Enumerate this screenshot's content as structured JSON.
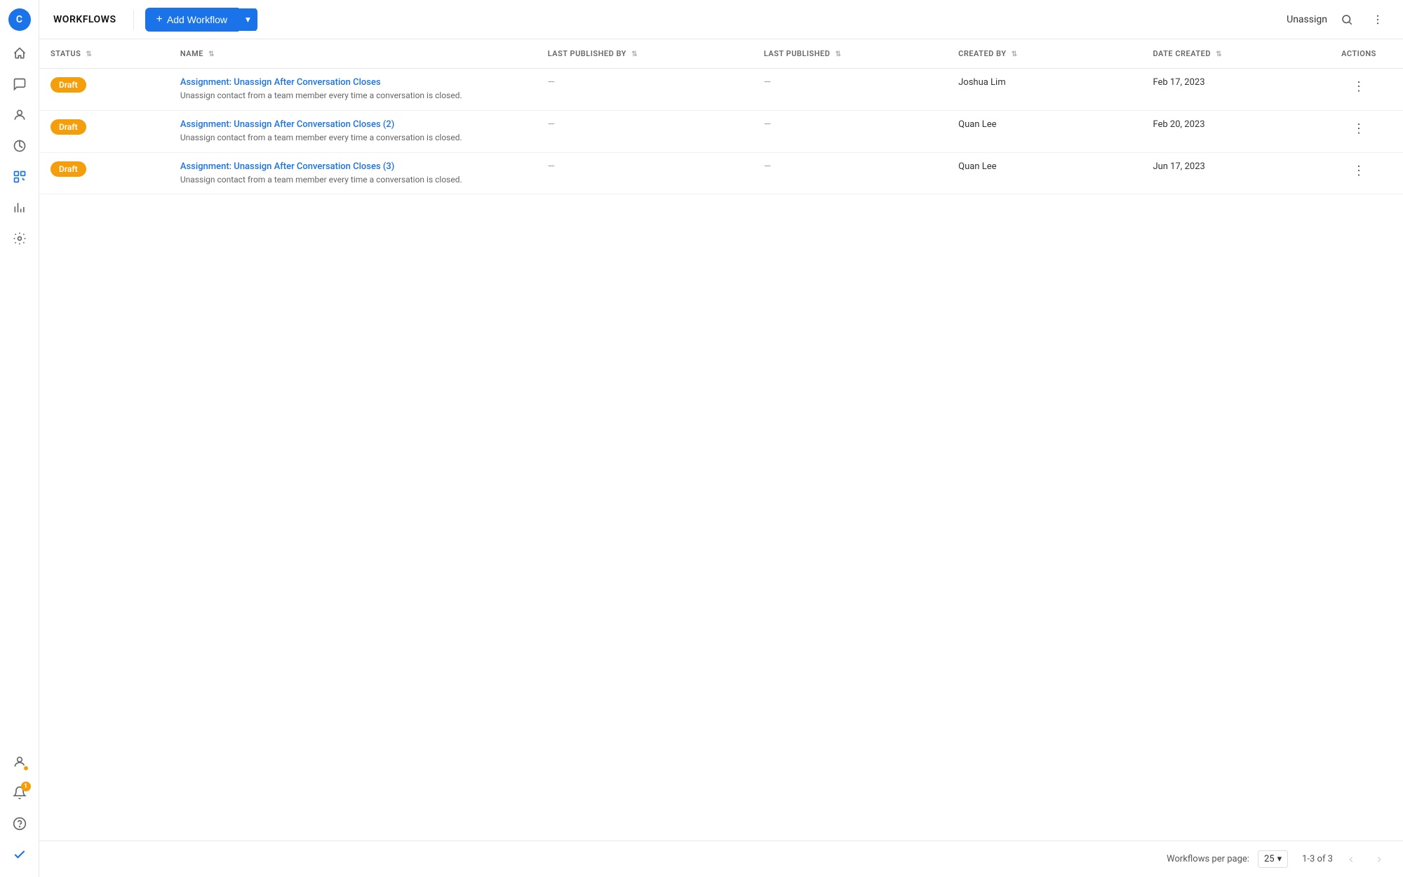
{
  "sidebar": {
    "avatar_letter": "C",
    "items": [
      {
        "name": "nav-home",
        "icon": "home",
        "active": false
      },
      {
        "name": "nav-conversations",
        "icon": "chat",
        "active": false
      },
      {
        "name": "nav-contacts",
        "icon": "person",
        "active": false
      },
      {
        "name": "nav-reports",
        "icon": "chart",
        "active": false
      },
      {
        "name": "nav-workflows",
        "icon": "workflow",
        "active": true
      },
      {
        "name": "nav-analytics",
        "icon": "bar",
        "active": false
      },
      {
        "name": "nav-settings",
        "icon": "gear",
        "active": false
      }
    ],
    "bottom_items": [
      {
        "name": "nav-user-status",
        "icon": "user"
      },
      {
        "name": "nav-notifications",
        "icon": "bell",
        "badge": "1"
      },
      {
        "name": "nav-help",
        "icon": "help"
      },
      {
        "name": "nav-checkmark",
        "icon": "check"
      }
    ]
  },
  "topbar": {
    "title": "WORKFLOWS",
    "add_button_label": "Add Workflow",
    "unassign_label": "Unassign"
  },
  "table": {
    "columns": {
      "status": "STATUS",
      "name": "NAME",
      "last_published_by": "LAST PUBLISHED BY",
      "last_published": "LAST PUBLISHED",
      "created_by": "CREATED BY",
      "date_created": "DATE CREATED",
      "actions": "ACTIONS"
    },
    "rows": [
      {
        "status": "Draft",
        "name": "Assignment: Unassign After Conversation Closes",
        "description": "Unassign contact from a team member every time a conversation is closed.",
        "last_published_by": "—",
        "last_published": "—",
        "created_by": "Joshua Lim",
        "date_created": "Feb 17, 2023"
      },
      {
        "status": "Draft",
        "name": "Assignment: Unassign After Conversation Closes (2)",
        "description": "Unassign contact from a team member every time a conversation is closed.",
        "last_published_by": "—",
        "last_published": "—",
        "created_by": "Quan Lee",
        "date_created": "Feb 20, 2023"
      },
      {
        "status": "Draft",
        "name": "Assignment: Unassign After Conversation Closes (3)",
        "description": "Unassign contact from a team member every time a conversation is closed.",
        "last_published_by": "—",
        "last_published": "—",
        "created_by": "Quan Lee",
        "date_created": "Jun 17, 2023"
      }
    ]
  },
  "footer": {
    "per_page_label": "Workflows per page:",
    "per_page_value": "25",
    "pagination_info": "1-3 of 3"
  }
}
